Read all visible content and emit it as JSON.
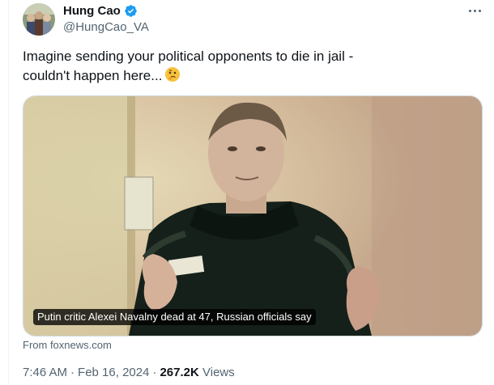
{
  "author": {
    "display_name": "Hung Cao",
    "handle": "@HungCao_VA",
    "verified_color": "#1d9bf0"
  },
  "tweet": {
    "line1": "Imagine sending your political opponents to die in jail -",
    "line2": "couldn't happen here...",
    "emoji": "thinking-face"
  },
  "card": {
    "headline": "Putin critic Alexei Navalny dead at 47, Russian officials say",
    "source": "From foxnews.com"
  },
  "meta": {
    "time": "7:46 AM",
    "separator": "·",
    "date": "Feb 16, 2024",
    "views_count": "267.2K",
    "views_label": "Views"
  }
}
